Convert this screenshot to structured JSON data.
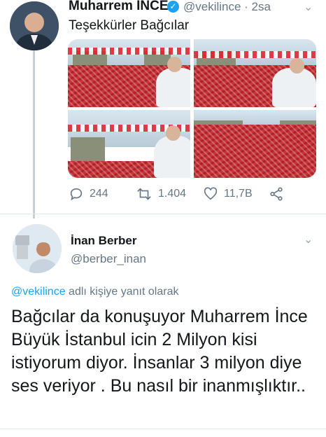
{
  "tweet_top": {
    "author_name": "Muharrem İNCE",
    "handle_time": "@vekilince · 2sa",
    "text": "Teşekkürler Bağcılar",
    "actions": {
      "reply_count": "244",
      "retweet_count": "1.404",
      "like_count": "11,7B"
    }
  },
  "tweet_reply": {
    "author_name": "İnan Berber",
    "handle": "@berber_inan",
    "reply_mention": "@vekilince",
    "reply_suffix": " adlı kişiye yanıt olarak",
    "text": "Bağcılar da konuşuyor Muharrem İnce Büyük İstanbul icin 2 Milyon kisi istiyorum diyor. İnsanlar 3 milyon diye ses veriyor . Bu nasıl bir inanmışlıktır.."
  },
  "colors": {
    "accent": "#1da1f2",
    "muted_text": "#657786",
    "rally_red": "#c8333a"
  },
  "icons": [
    "verified-icon",
    "chevron-down-icon",
    "reply-icon",
    "retweet-icon",
    "like-icon",
    "share-icon"
  ]
}
